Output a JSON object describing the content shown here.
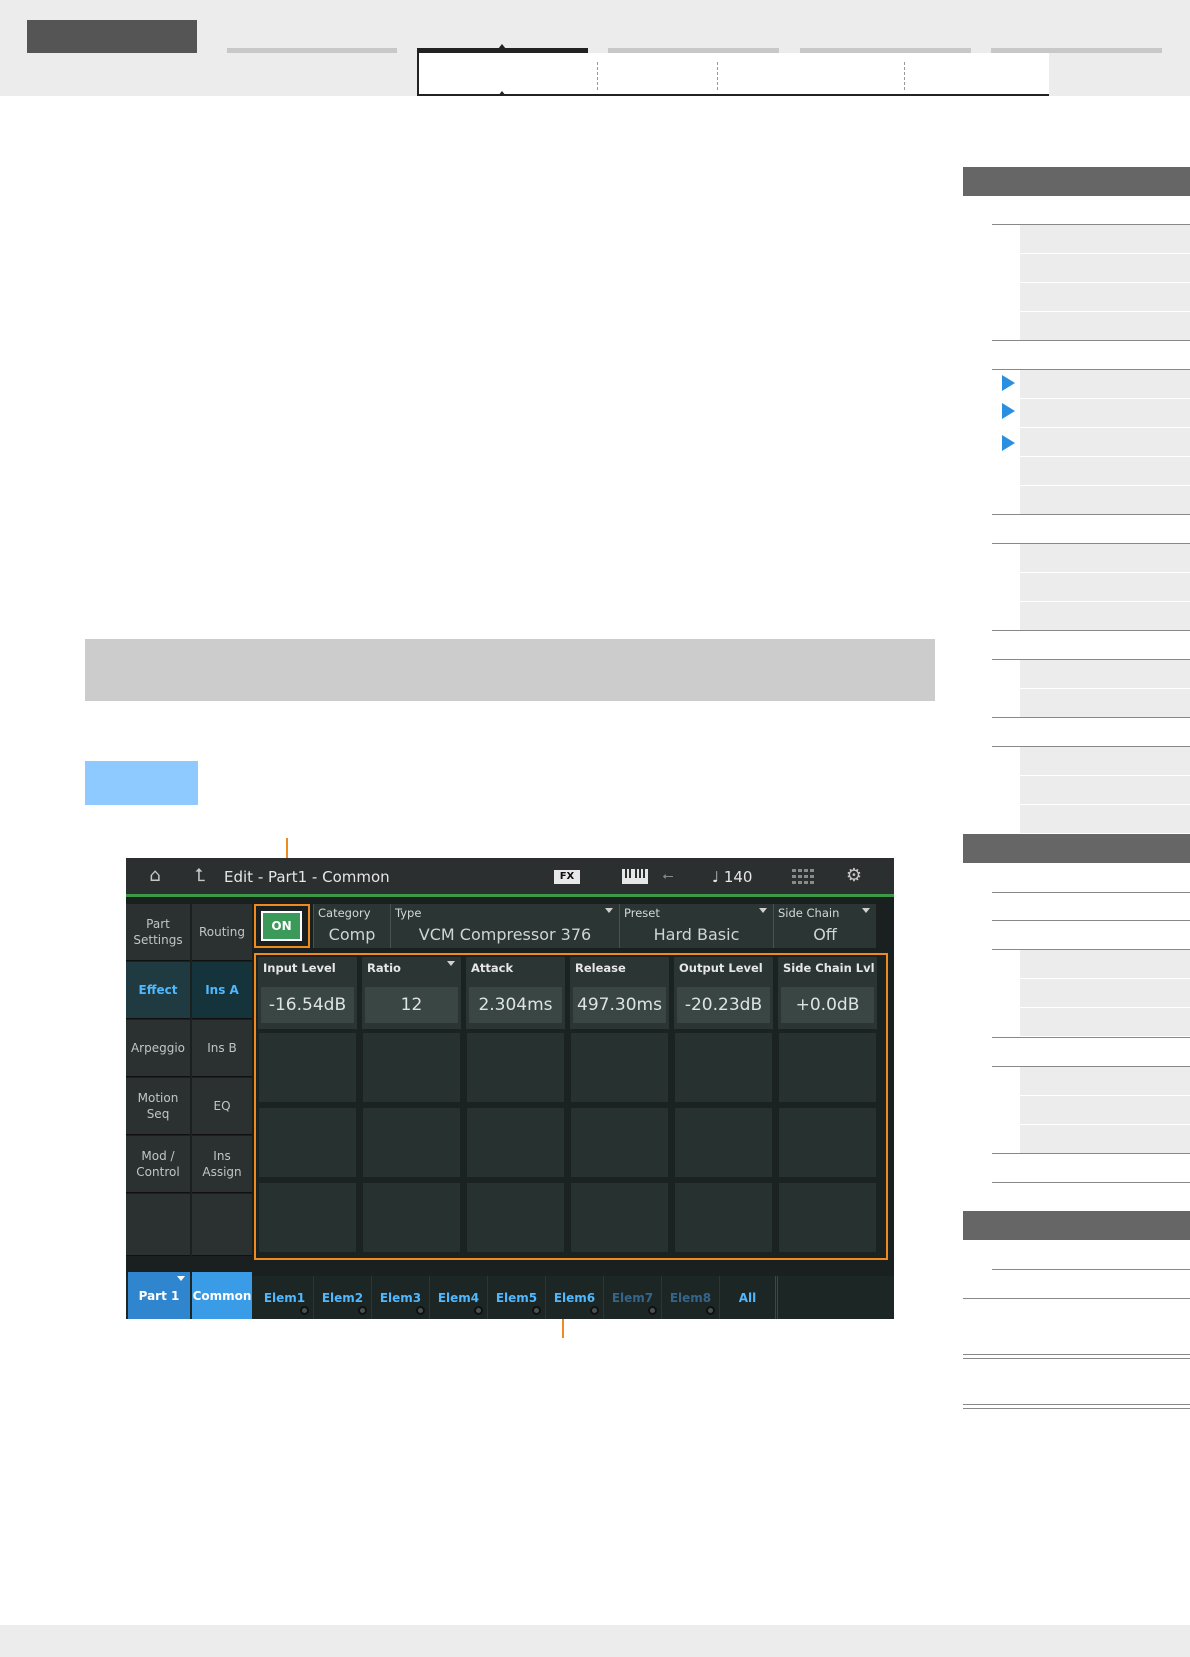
{
  "screen": {
    "title": "Edit - Part1 - Common",
    "fx_badge": "FX",
    "tempo": "♩ 140",
    "icons": [
      "home-icon",
      "back-arrow-icon",
      "keyboard-icon",
      "usb-icon",
      "grid-icon",
      "gear-icon"
    ],
    "nav_col1": [
      "Part Settings",
      "Effect",
      "Arpeggio",
      "Motion Seq",
      "Mod / Control"
    ],
    "nav_col2": [
      "Routing",
      "Ins A",
      "Ins B",
      "EQ",
      "Ins Assign"
    ],
    "on_label": "ON",
    "header_params": [
      {
        "label": "Category",
        "value": "Comp"
      },
      {
        "label": "Type",
        "value": "VCM Compressor 376"
      },
      {
        "label": "Preset",
        "value": "Hard Basic"
      },
      {
        "label": "Side Chain",
        "value": "Off"
      }
    ],
    "knobs": [
      {
        "label": "Input Level",
        "value": "-16.54dB"
      },
      {
        "label": "Ratio",
        "value": "12"
      },
      {
        "label": "Attack",
        "value": "2.304ms"
      },
      {
        "label": "Release",
        "value": "497.30ms"
      },
      {
        "label": "Output Level",
        "value": "-20.23dB"
      },
      {
        "label": "Side Chain Lvl",
        "value": "+0.0dB"
      }
    ],
    "part_tab": "Part 1",
    "common_tab": "Common",
    "elem_tabs": [
      "Elem1",
      "Elem2",
      "Elem3",
      "Elem4",
      "Elem5",
      "Elem6",
      "Elem7",
      "Elem8",
      "All"
    ],
    "accent_color": "#4fb8ff",
    "callout_color": "#ee8a1e"
  }
}
